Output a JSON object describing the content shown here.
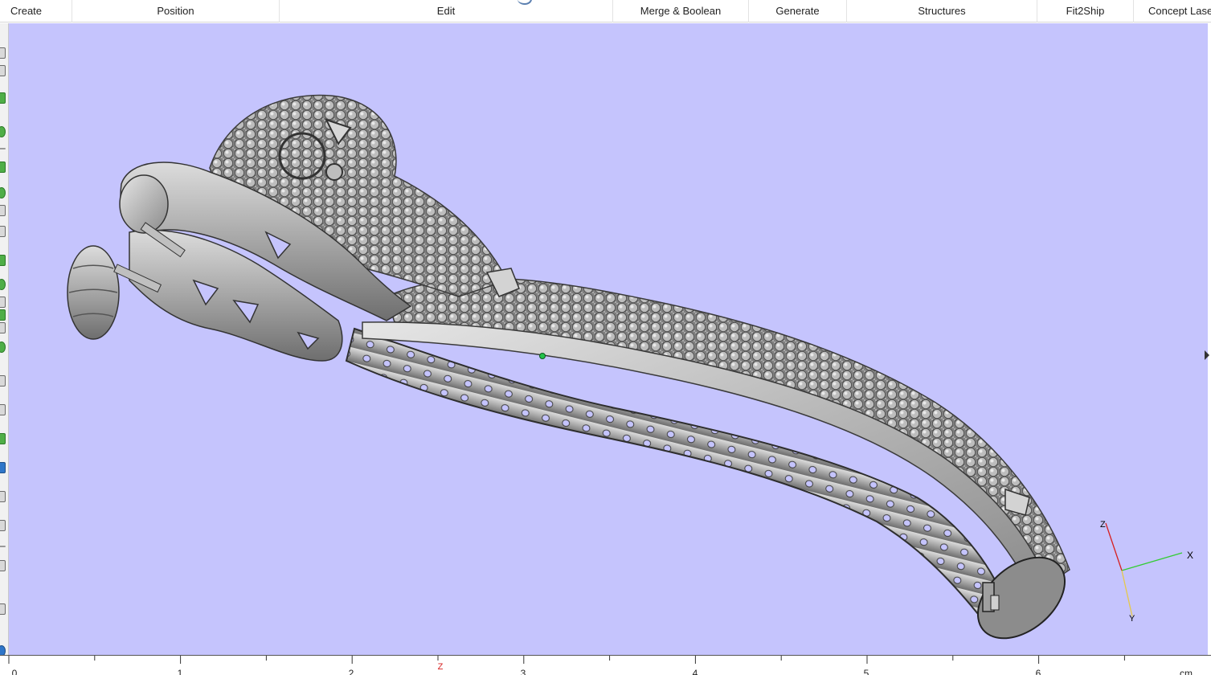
{
  "menubar": {
    "items": [
      {
        "label": "Create"
      },
      {
        "label": "Position"
      },
      {
        "label": "Edit"
      },
      {
        "label": "Merge & Boolean"
      },
      {
        "label": "Generate"
      },
      {
        "label": "Structures"
      },
      {
        "label": "Fit2Ship"
      },
      {
        "label": "Concept Lase"
      }
    ]
  },
  "viewport": {
    "background_color": "#c5c4fd",
    "model_color": "#9a9a9a",
    "pick_point_color": "#22c24b",
    "axes": {
      "x_label": "X",
      "y_label": "Y",
      "z_label": "Z",
      "x_color": "#33cc33",
      "y_color": "#e6c84a",
      "z_color": "#d62020"
    }
  },
  "ruler": {
    "unit": "cm",
    "labels": [
      "0",
      "1",
      "2",
      "3",
      "4",
      "5",
      "6"
    ],
    "marker_label": "Z"
  },
  "left_toolbar": {
    "icons": [
      "select-icon",
      "move-icon",
      "pen-icon",
      "sphere-icon",
      "cube-icon",
      "ring-icon",
      "cut-icon",
      "line-icon",
      "box-icon",
      "gem-icon",
      "prong-icon",
      "diamond-icon",
      "link-icon",
      "globe-icon",
      "scissors-icon",
      "page-icon",
      "layer-icon",
      "blue-tool-icon",
      "copy-icon",
      "paste-icon",
      "measure-icon",
      "brush-icon"
    ]
  }
}
